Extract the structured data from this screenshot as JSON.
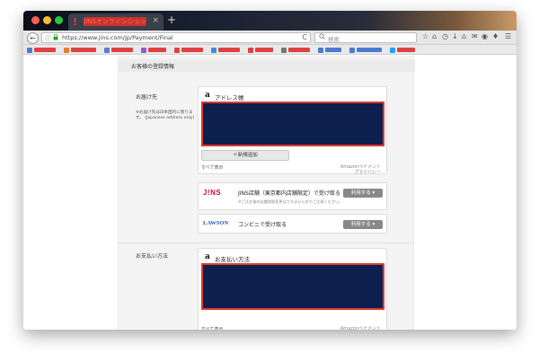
{
  "browser": {
    "tab_title": "JINSオンラインショップ",
    "tab_alert_icon": "!",
    "tab_close_icon": "×",
    "new_tab_icon": "+",
    "url": "https://www.jins.com/jp/Payment/Final",
    "search_placeholder": "検索",
    "back_icon": "←",
    "info_icon": "ⓘ",
    "lock_icon": "🔒",
    "reload_icon": "C",
    "search_icon": "Q",
    "toolbar_icons": [
      "☆",
      "⌂",
      "◷",
      "↓",
      "⌂",
      "✉",
      "◉",
      "♦",
      "☰"
    ]
  },
  "bookmarks": [
    {
      "color": "#4a7bd0",
      "label_color": "#e04040"
    },
    {
      "color": "#e67e22",
      "label_color": "#e04040"
    },
    {
      "color": "#5b7bd5",
      "label_color": "#e04040"
    },
    {
      "color": "#8e5bd5",
      "label_color": "#e04040"
    },
    {
      "color": "#e04040",
      "label_color": "#e04040"
    },
    {
      "color": "#3c8dd8",
      "label_color": "#e04040"
    },
    {
      "color": "#e04040",
      "label_color": "#e04040"
    },
    {
      "color": "#777777",
      "label_color": "#e04040"
    },
    {
      "color": "#4a7bd0",
      "label_color": "#4a7bd0"
    },
    {
      "color": "#4a7bd0",
      "label_color": "#4a7bd0"
    },
    {
      "color": "#1da1f2",
      "label_color": "#e04040"
    }
  ],
  "page": {
    "section_header": "お客様の登録情報",
    "shipping_label": "お届け先",
    "shipping_note": "※お届け先は日本国内に限ります。 (Japanese address only)",
    "address_book_icon": "a",
    "address_book_title": "アドレス帳",
    "add_new": "＋新規追加",
    "see_all": "すべて表示",
    "amazon_pay_line1": "Amazonペイメント",
    "amazon_pay_line2": "プライバシー",
    "jins_logo": "J!NS",
    "jins_option_title": "JINS店舗（東京都内店舗限定）で受け取る",
    "jins_option_sub": "※ご注文後の店舗受取変更はできませんのでご注意ください。",
    "use_button": "利用する ▾",
    "lawson_logo": "LAWSON",
    "lawson_option_title": "コンビニで受け取る",
    "payment_label": "お支払い方法",
    "payment_title": "お支払い方法",
    "colors": {
      "redbox_fill": "#0d1f4f",
      "redbox_border": "#e03a2a",
      "jins_red": "#c8102e",
      "lawson_blue": "#1e5aa8"
    }
  }
}
